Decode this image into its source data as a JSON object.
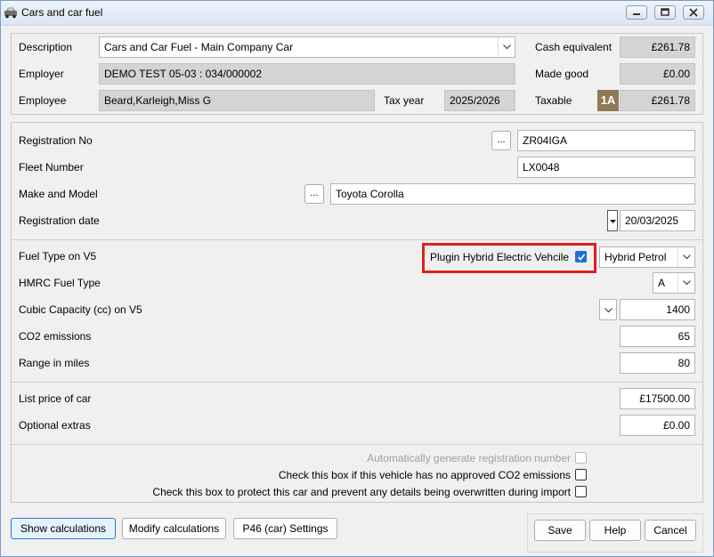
{
  "window": {
    "title": "Cars and car fuel"
  },
  "header": {
    "description_label": "Description",
    "description_value": "Cars and Car Fuel - Main Company Car",
    "employer_label": "Employer",
    "employer_value": "DEMO TEST 05-03 : 034/000002",
    "employee_label": "Employee",
    "employee_value": "Beard,Karleigh,Miss G",
    "tax_year_label": "Tax year",
    "tax_year_value": "2025/2026",
    "cash_equivalent_label": "Cash equivalent",
    "cash_equivalent_value": "£261.78",
    "made_good_label": "Made good",
    "made_good_value": "£0.00",
    "taxable_label": "Taxable",
    "taxable_badge": "1A",
    "taxable_value": "£261.78"
  },
  "vehicle": {
    "registration_no_label": "Registration No",
    "registration_no_value": "ZR04IGA",
    "fleet_number_label": "Fleet Number",
    "fleet_number_value": "LX0048",
    "make_model_label": "Make and Model",
    "make_model_value": "Toyota Corolla",
    "registration_date_label": "Registration date",
    "registration_date_value": "20/03/2025",
    "ellipsis": "..."
  },
  "fuel": {
    "fuel_type_label": "Fuel Type on V5",
    "phev_label": "Plugin Hybrid Electric Vehcile",
    "phev_checked": true,
    "fuel_type_value": "Hybrid Petrol",
    "hmrc_fuel_type_label": "HMRC Fuel Type",
    "hmrc_fuel_type_value": "A",
    "cc_label": "Cubic Capacity (cc) on V5",
    "cc_value": "1400",
    "co2_label": "CO2 emissions",
    "co2_value": "65",
    "range_label": "Range in miles",
    "range_value": "80"
  },
  "price": {
    "list_price_label": "List price of car",
    "list_price_value": "£17500.00",
    "extras_label": "Optional extras",
    "extras_value": "£0.00"
  },
  "options": {
    "auto_reg_label": "Automatically generate registration number",
    "no_co2_label": "Check this box if this vehicle has no approved CO2 emissions",
    "protect_label": "Check this box to protect this car and prevent any details being overwritten during import"
  },
  "buttons": {
    "show_calculations": "Show calculations",
    "modify_calculations": "Modify calculations",
    "p46_settings": "P46 (car) Settings",
    "save": "Save",
    "help": "Help",
    "cancel": "Cancel"
  },
  "colors": {
    "highlight_border": "#e0201c",
    "badge_bg": "#8f7a56",
    "checkbox_checked": "#1e6fd9"
  }
}
